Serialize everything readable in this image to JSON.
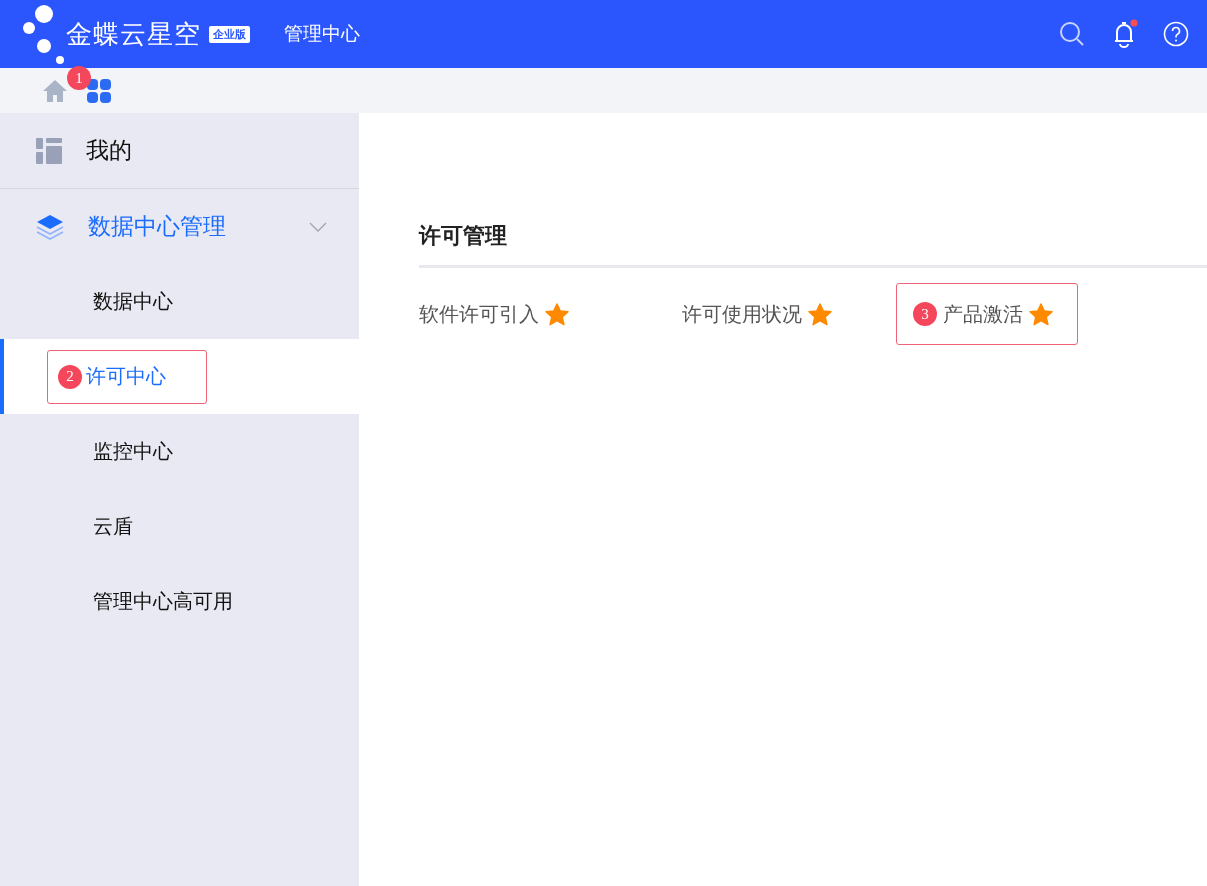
{
  "header": {
    "logo_text": "金蝶云星空",
    "logo_badge": "企业版",
    "title": "管理中心",
    "notification_unread": true
  },
  "toolbar": {
    "callout": "1"
  },
  "sidebar": {
    "items": [
      {
        "label": "我的",
        "kind": "top",
        "selected": false
      },
      {
        "label": "数据中心管理",
        "kind": "group",
        "expanded": true,
        "selected": true,
        "children": [
          {
            "label": "数据中心",
            "selected": false
          },
          {
            "label": "许可中心",
            "selected": true,
            "callout": "2"
          },
          {
            "label": "监控中心",
            "selected": false
          },
          {
            "label": "云盾",
            "selected": false
          },
          {
            "label": "管理中心高可用",
            "selected": false
          }
        ]
      }
    ]
  },
  "content": {
    "heading": "许可管理",
    "links": [
      {
        "label": "软件许可引入",
        "favorite": true
      },
      {
        "label": "许可使用状况",
        "favorite": true
      },
      {
        "label": "产品激活",
        "favorite": true,
        "callout": "3"
      }
    ]
  }
}
